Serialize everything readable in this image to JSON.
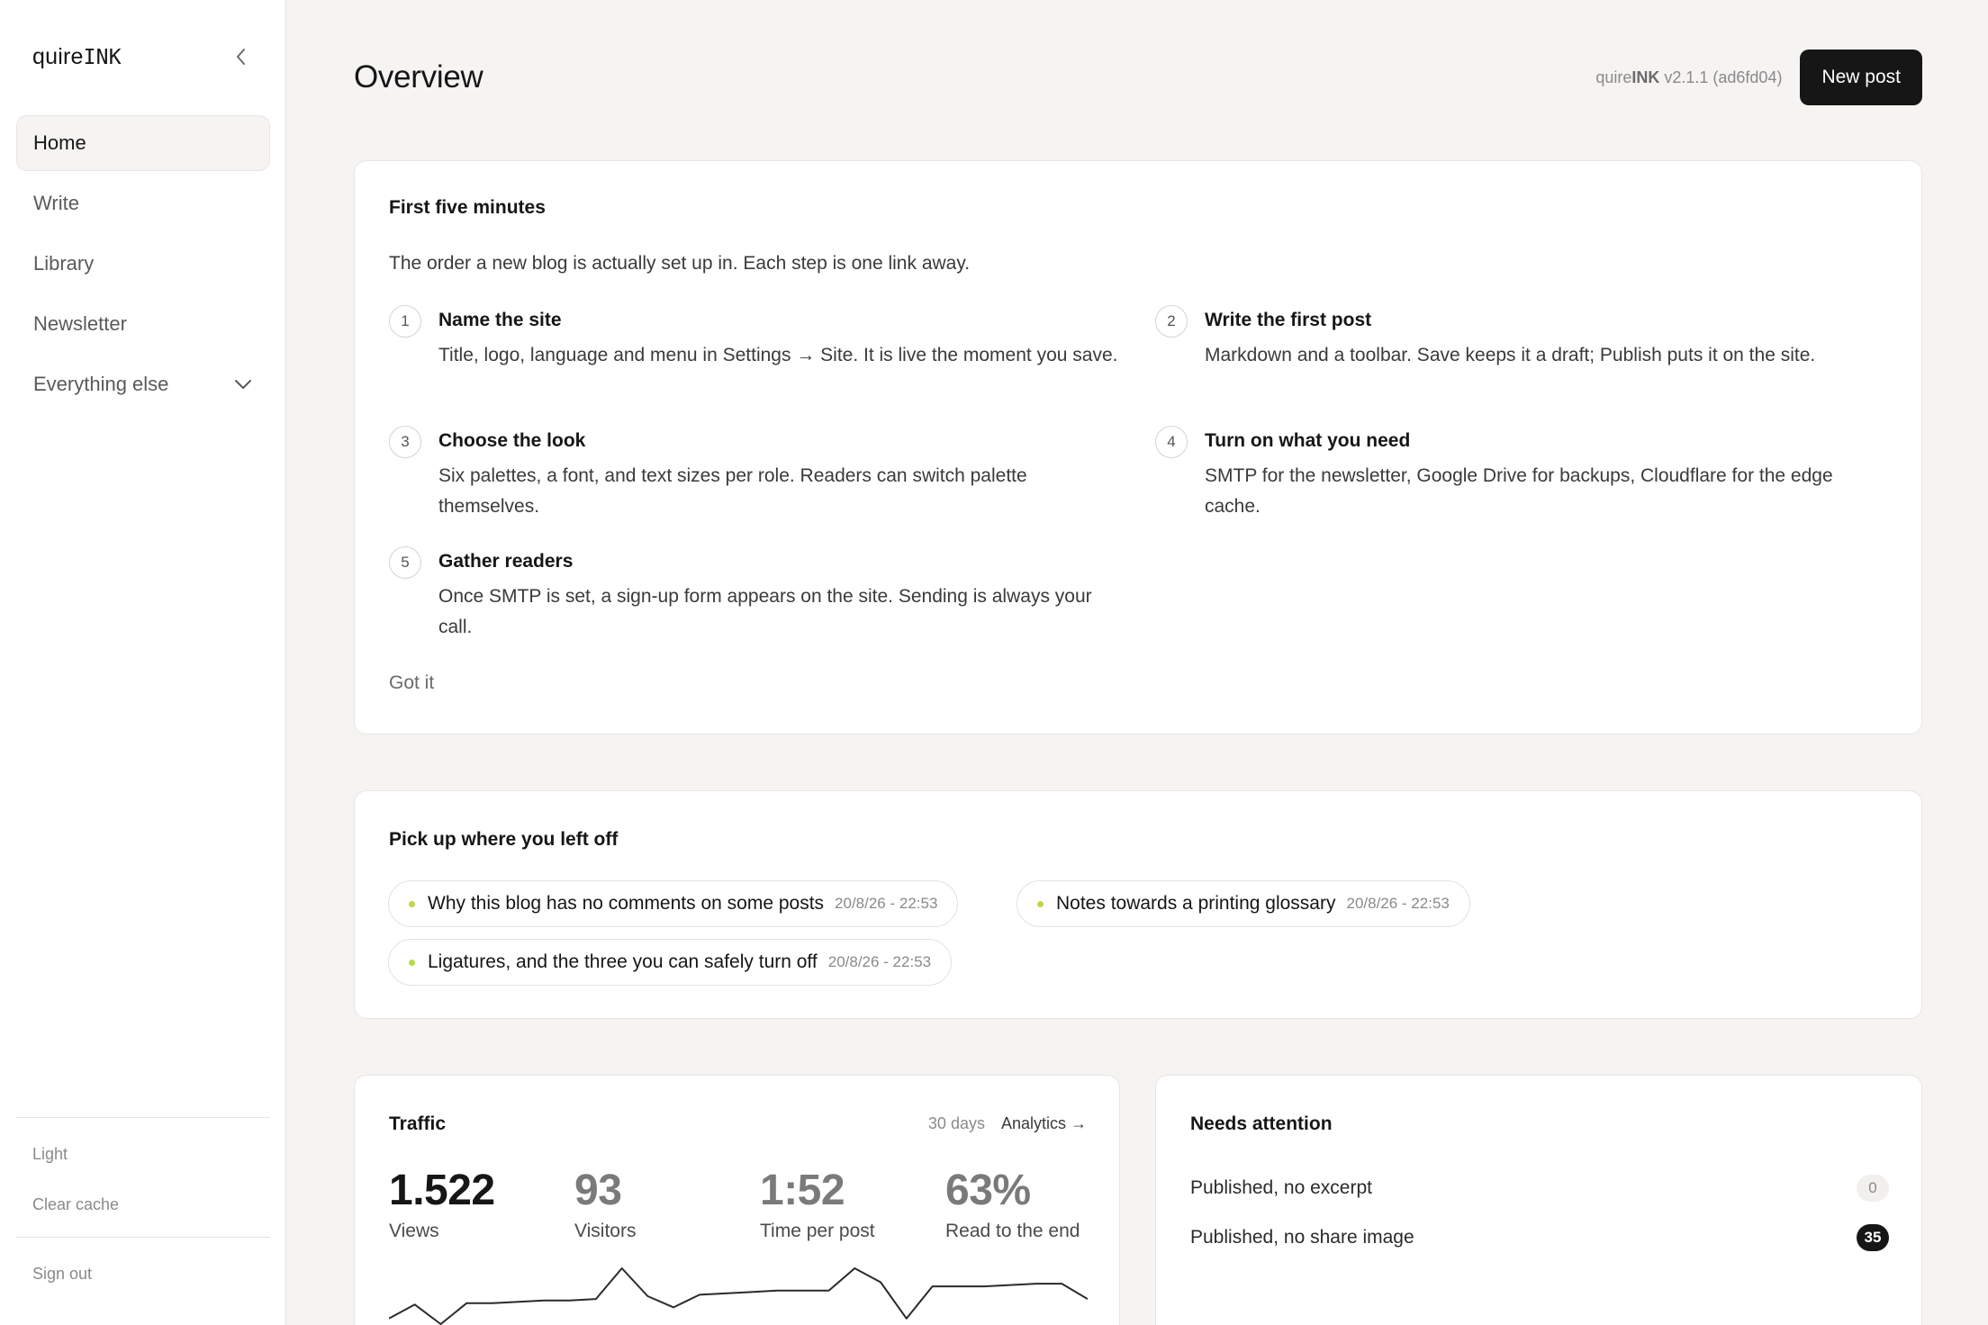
{
  "sidebar": {
    "brand_prefix": "quire",
    "brand_suffix": "INK",
    "items": [
      {
        "label": "Home"
      },
      {
        "label": "Write"
      },
      {
        "label": "Library"
      },
      {
        "label": "Newsletter"
      },
      {
        "label": "Everything else"
      }
    ],
    "theme_label": "Light",
    "clear_cache_label": "Clear cache",
    "sign_out_label": "Sign out"
  },
  "header": {
    "title": "Overview",
    "version_prefix": "quire",
    "version_brand": "INK",
    "version_suffix": " v2.1.1 (ad6fd04)",
    "new_post_label": "New post"
  },
  "onboarding": {
    "title": "First five minutes",
    "intro": "The order a new blog is actually set up in. Each step is one link away.",
    "steps": [
      {
        "num": "1",
        "title": "Name the site",
        "desc": "Title, logo, language and menu in Settings → Site. It is live the moment you save."
      },
      {
        "num": "2",
        "title": "Write the first post",
        "desc": "Markdown and a toolbar. Save keeps it a draft; Publish puts it on the site."
      },
      {
        "num": "3",
        "title": "Choose the look",
        "desc": "Six palettes, a font, and text sizes per role. Readers can switch palette themselves."
      },
      {
        "num": "4",
        "title": "Turn on what you need",
        "desc": "SMTP for the newsletter, Google Drive for backups, Cloudflare for the edge cache."
      },
      {
        "num": "5",
        "title": "Gather readers",
        "desc": "Once SMTP is set, a sign-up form appears on the site. Sending is always your call."
      }
    ],
    "dismiss_label": "Got it"
  },
  "resume": {
    "title": "Pick up where you left off",
    "posts": [
      {
        "title": "Why this blog has no comments on some posts",
        "stamp": "20/8/26 - 22:53"
      },
      {
        "title": "Notes towards a printing glossary",
        "stamp": "20/8/26 - 22:53"
      },
      {
        "title": "Ligatures, and the three you can safely turn off",
        "stamp": "20/8/26 - 22:53"
      }
    ]
  },
  "traffic": {
    "title": "Traffic",
    "range": "30 days",
    "analytics_link": "Analytics →",
    "stats": [
      {
        "value": "1.522",
        "label": "Views"
      },
      {
        "value": "93",
        "label": "Visitors"
      },
      {
        "value": "1:52",
        "label": "Time per post"
      },
      {
        "value": "63%",
        "label": "Read to the end"
      }
    ],
    "sparkline": [
      22,
      32,
      18,
      33,
      33,
      34,
      35,
      35,
      36,
      58,
      38,
      30,
      39,
      40,
      41,
      42,
      42,
      42,
      58,
      48,
      22,
      45,
      45,
      45,
      46,
      47,
      47,
      36
    ]
  },
  "attention": {
    "title": "Needs attention",
    "items": [
      {
        "label": "Published, no excerpt",
        "count": "0"
      },
      {
        "label": "Published, no share image",
        "count": "35"
      }
    ]
  },
  "colors": {
    "accent_dot": "#b9d94a",
    "primary_button": "#161616",
    "background": "#f5f4f2"
  }
}
